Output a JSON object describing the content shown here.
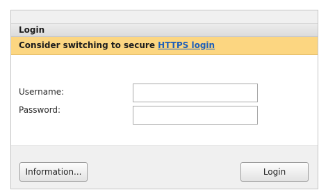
{
  "login_panel": {
    "title": "Login",
    "notice": {
      "text": "Consider switching to secure",
      "link_text": "HTTPS login"
    },
    "username": {
      "label": "Username:",
      "value": "",
      "placeholder": ""
    },
    "password": {
      "label": "Password:",
      "value": "",
      "placeholder": ""
    },
    "buttons": {
      "information_label": "Information...",
      "login_label": "Login"
    }
  }
}
